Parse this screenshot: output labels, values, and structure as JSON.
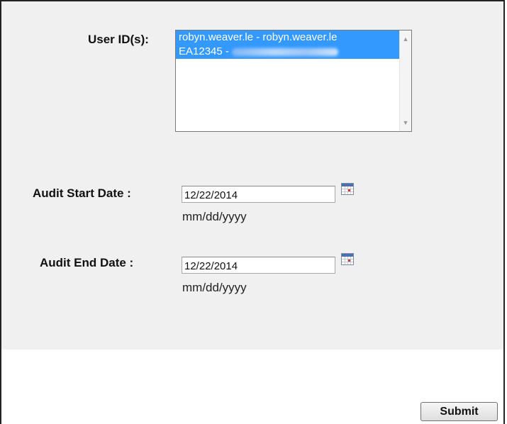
{
  "form": {
    "user_ids_label": "User ID(s):",
    "user_list": [
      "robyn.weaver.le - robyn.weaver.le",
      "EA12345 -"
    ],
    "start_label": "Audit Start Date :",
    "start_value": "12/22/2014",
    "start_hint": "mm/dd/yyyy",
    "end_label": "Audit End Date :",
    "end_value": "12/22/2014",
    "end_hint": "mm/dd/yyyy",
    "submit_label": "Submit"
  },
  "icons": {
    "calendar": "calendar-icon",
    "scroll_up": "scroll-up-arrow-icon",
    "scroll_down": "scroll-down-arrow-icon"
  },
  "colors": {
    "selection": "#3399ff",
    "panel_background": "#f0f0f0"
  }
}
